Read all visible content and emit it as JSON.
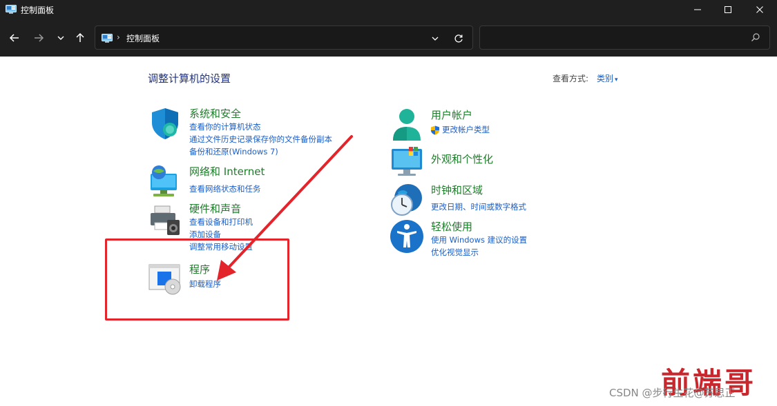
{
  "window": {
    "title": "控制面板",
    "app_icon": "control-panel-icon",
    "controls": [
      "minimize-icon",
      "maximize-icon",
      "close-icon"
    ]
  },
  "navbar": {
    "buttons": [
      "back-arrow-icon",
      "forward-arrow-icon",
      "chevron-down-icon",
      "up-arrow-icon"
    ],
    "address": {
      "icon": "control-panel-icon",
      "separator": "›",
      "path": "控制面板"
    },
    "search": {
      "placeholder": "",
      "icon": "search-icon"
    }
  },
  "content": {
    "title": "调整计算机的设置",
    "view_by": {
      "label": "查看方式:",
      "value": "类别"
    }
  },
  "categories_left": [
    {
      "id": "system-security",
      "title": "系统和安全",
      "icon": "shield-icon",
      "links": [
        "查看你的计算机状态",
        "通过文件历史记录保存你的文件备份副本",
        "备份和还原(Windows 7)"
      ]
    },
    {
      "id": "network-internet",
      "title": "网络和 Internet",
      "icon": "network-globe-icon",
      "links": [
        "查看网络状态和任务"
      ]
    },
    {
      "id": "hardware-sound",
      "title": "硬件和声音",
      "icon": "printer-speaker-icon",
      "links": [
        "查看设备和打印机",
        "添加设备",
        "调整常用移动设置"
      ]
    },
    {
      "id": "programs",
      "title": "程序",
      "icon": "programs-disc-icon",
      "links": [
        "卸载程序"
      ]
    }
  ],
  "categories_right": [
    {
      "id": "user-accounts",
      "title": "用户帐户",
      "icon": "user-icon",
      "links": [
        "更改帐户类型"
      ],
      "link_icon": "uac-shield-icon"
    },
    {
      "id": "appearance",
      "title": "外观和个性化",
      "icon": "monitor-icon",
      "links": []
    },
    {
      "id": "clock-region",
      "title": "时钟和区域",
      "icon": "clock-globe-icon",
      "links": [
        "更改日期、时间或数字格式"
      ]
    },
    {
      "id": "ease-of-access",
      "title": "轻松使用",
      "icon": "accessibility-icon",
      "links": [
        "使用 Windows 建议的设置",
        "优化视觉显示"
      ]
    }
  ],
  "annotation": {
    "color": "#e3242b",
    "shape": "red-box-with-arrow"
  },
  "watermarks": {
    "csdn": "CSDN @步行生花@苏思正",
    "brand": "前端哥"
  },
  "colors": {
    "titlebar": "#1f1f1f",
    "category_title": "#1e7d2a",
    "link": "#1a5ec8",
    "page_title": "#1e3287"
  }
}
